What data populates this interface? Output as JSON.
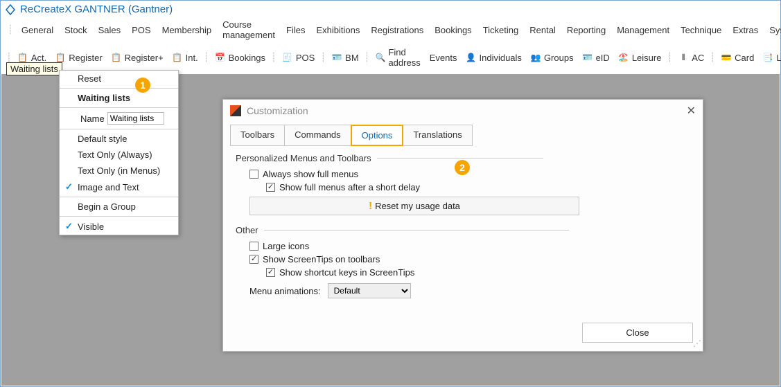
{
  "title": "ReCreateX GANTNER  (Gantner)",
  "menubar": [
    "General",
    "Stock",
    "Sales",
    "POS",
    "Membership",
    "Course management",
    "Files",
    "Exhibitions",
    "Registrations",
    "Bookings",
    "Ticketing",
    "Rental",
    "Reporting",
    "Management",
    "Technique",
    "Extras",
    "System"
  ],
  "toolbar": [
    "Act.",
    "Register",
    "Register+",
    "Int.",
    "Bookings",
    "POS",
    "BM",
    "Find address",
    "Events",
    "Individuals",
    "Groups",
    "eID",
    "Leisure",
    "AC",
    "Card",
    "Logging"
  ],
  "tag_label": "Waiting lists",
  "contextmenu": {
    "reset": "Reset",
    "bold_item": "Waiting lists",
    "name_label": "Name",
    "name_value": "Waiting lists",
    "items": [
      "Default style",
      "Text Only (Always)",
      "Text Only (in Menus)",
      "Image and Text",
      "Begin a Group",
      "Visible"
    ],
    "checked": {
      "Image and Text": true,
      "Visible": true
    }
  },
  "annotations": {
    "one": "1",
    "two": "2"
  },
  "dialog": {
    "title": "Customization",
    "tabs": [
      "Toolbars",
      "Commands",
      "Options",
      "Translations"
    ],
    "active_tab": "Options",
    "group1": {
      "title": "Personalized Menus and Toolbars",
      "always_full": {
        "label": "Always show full menus",
        "checked": false
      },
      "after_delay": {
        "label": "Show full menus after a short delay",
        "checked": true
      },
      "reset_btn": "Reset my usage data"
    },
    "group2": {
      "title": "Other",
      "large_icons": {
        "label": "Large icons",
        "checked": false
      },
      "screentips": {
        "label": "Show ScreenTips on toolbars",
        "checked": true
      },
      "shortcut_keys": {
        "label": "Show shortcut keys in ScreenTips",
        "checked": true
      },
      "menu_anim_label": "Menu animations:",
      "menu_anim_value": "Default"
    },
    "close_btn": "Close"
  }
}
